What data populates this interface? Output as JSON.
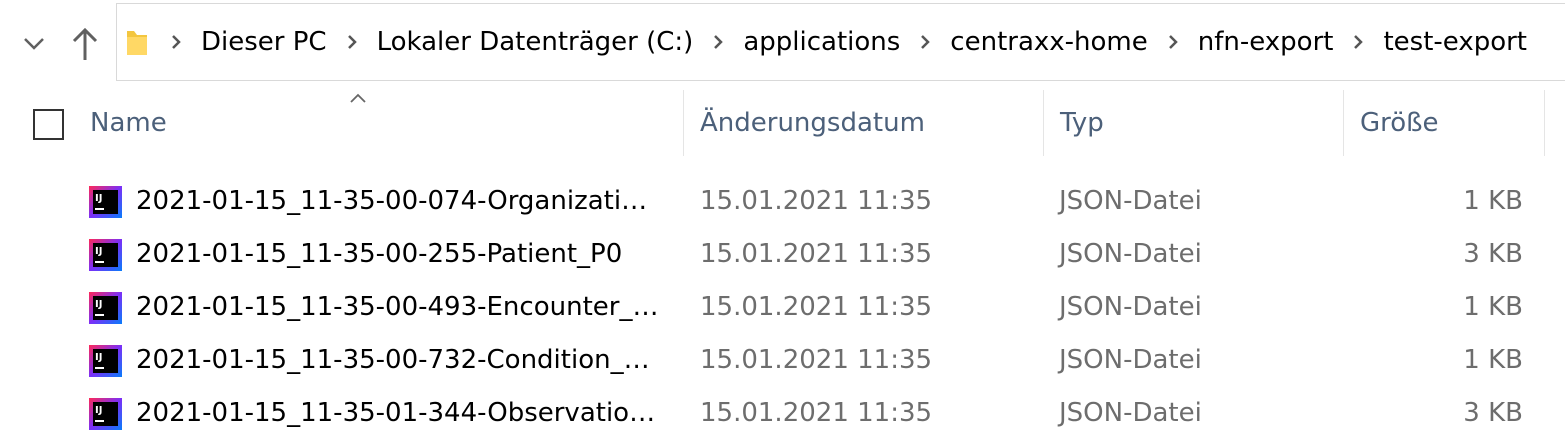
{
  "breadcrumb": [
    "Dieser PC",
    "Lokaler Datenträger (C:)",
    "applications",
    "centraxx-home",
    "nfn-export",
    "test-export"
  ],
  "columns": {
    "name": "Name",
    "modified": "Änderungsdatum",
    "type": "Typ",
    "size": "Größe"
  },
  "sort": {
    "column": "Name",
    "direction": "ascending"
  },
  "files": [
    {
      "name": "2021-01-15_11-35-00-074-Organizati…",
      "modified": "15.01.2021 11:35",
      "type": "JSON-Datei",
      "size": "1 KB"
    },
    {
      "name": "2021-01-15_11-35-00-255-Patient_P0",
      "modified": "15.01.2021 11:35",
      "type": "JSON-Datei",
      "size": "3 KB"
    },
    {
      "name": "2021-01-15_11-35-00-493-Encounter_…",
      "modified": "15.01.2021 11:35",
      "type": "JSON-Datei",
      "size": "1 KB"
    },
    {
      "name": "2021-01-15_11-35-00-732-Condition_…",
      "modified": "15.01.2021 11:35",
      "type": "JSON-Datei",
      "size": "1 KB"
    },
    {
      "name": "2021-01-15_11-35-01-344-Observatio…",
      "modified": "15.01.2021 11:35",
      "type": "JSON-Datei",
      "size": "3 KB"
    }
  ],
  "icons": {
    "file": "intellij-idea-icon",
    "folder": "folder-icon"
  },
  "colors": {
    "header_text": "#4c607a",
    "secondary_text": "#6d6d6d",
    "folder": "#f3c63f",
    "file_icon_gradient": [
      "#fe2857",
      "#7b2ff7",
      "#087cfa"
    ]
  }
}
